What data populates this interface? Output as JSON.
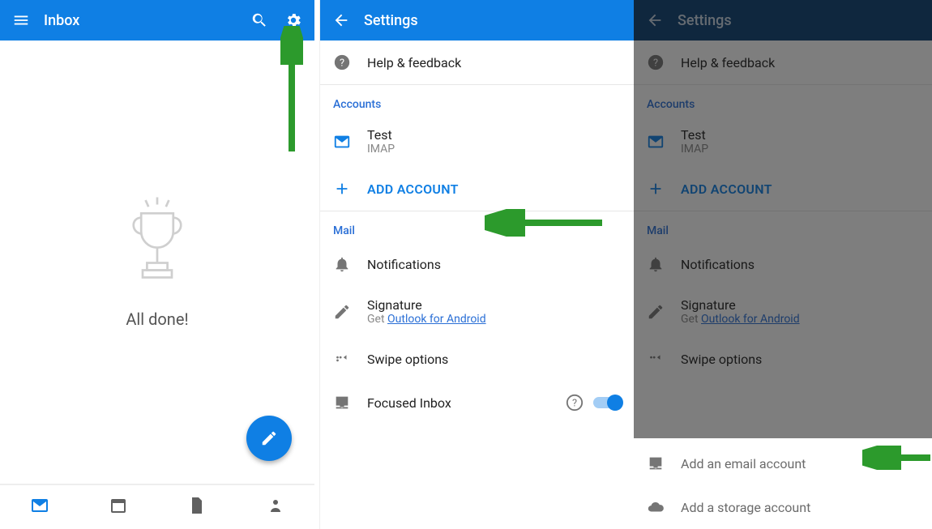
{
  "panel1": {
    "title": "Inbox",
    "empty_text": "All done!"
  },
  "panel2": {
    "title": "Settings",
    "help": "Help & feedback",
    "section_accounts": "Accounts",
    "account_name": "Test",
    "account_type": "IMAP",
    "add_account": "ADD ACCOUNT",
    "section_mail": "Mail",
    "notifications": "Notifications",
    "signature": "Signature",
    "signature_prefix": "Get ",
    "signature_link": "Outlook for Android",
    "swipe": "Swipe options",
    "focused": "Focused Inbox"
  },
  "panel3": {
    "title": "Settings",
    "help": "Help & feedback",
    "section_accounts": "Accounts",
    "account_name": "Test",
    "account_type": "IMAP",
    "add_account": "ADD ACCOUNT",
    "section_mail": "Mail",
    "notifications": "Notifications",
    "signature": "Signature",
    "signature_prefix": "Get ",
    "signature_link": "Outlook for Android",
    "swipe": "Swipe options",
    "sheet_email": "Add an email account",
    "sheet_storage": "Add a storage account"
  },
  "colors": {
    "primary": "#0F7FE4",
    "arrow": "#2C9A2C"
  }
}
